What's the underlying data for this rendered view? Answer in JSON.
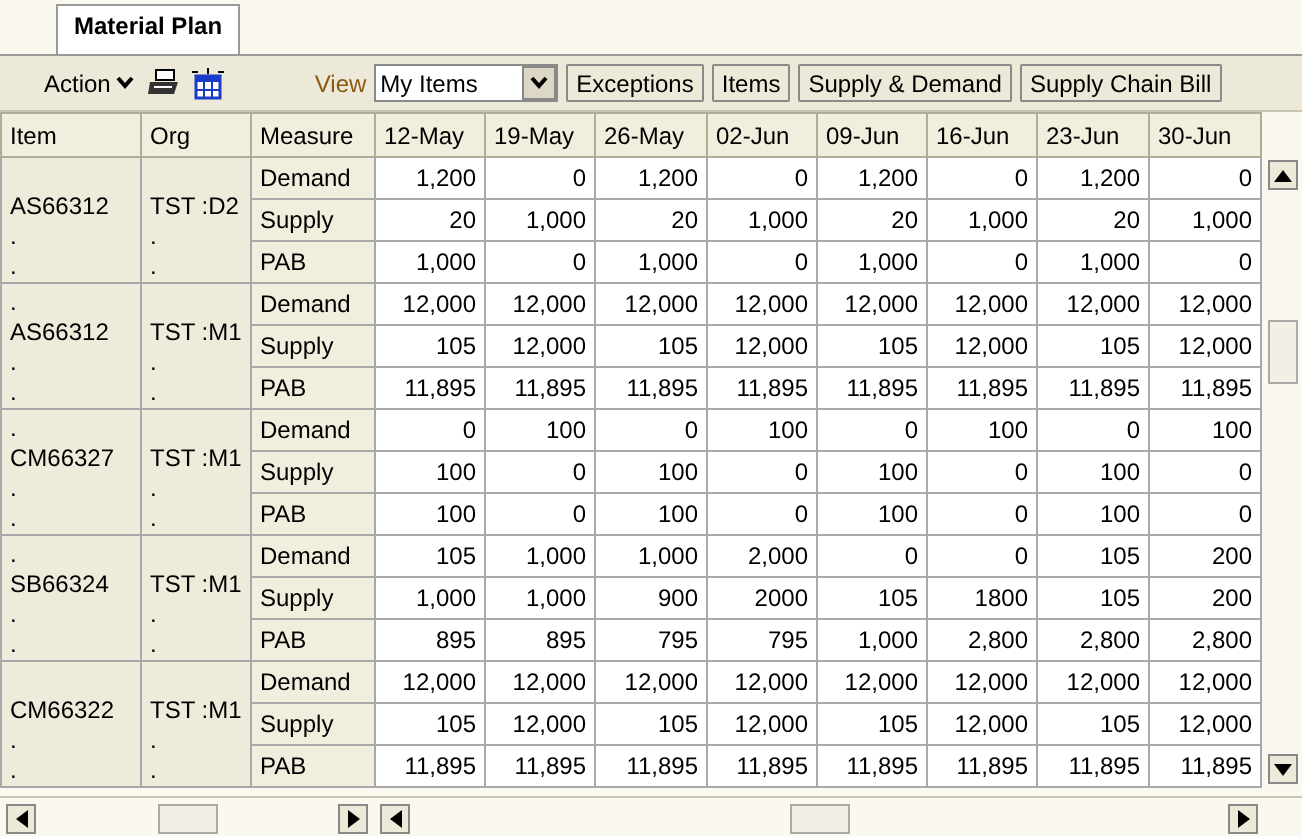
{
  "tabs": [
    {
      "label": "Material Plan",
      "selected": true
    }
  ],
  "toolbar": {
    "action_label": "Action",
    "view_label": "View",
    "view_value": "My Items",
    "buttons": [
      "Exceptions",
      "Items",
      "Supply & Demand",
      "Supply Chain Bill"
    ]
  },
  "table": {
    "columns": [
      "Item",
      "Org",
      "Measure",
      "12-May",
      "19-May",
      "26-May",
      "02-Jun",
      "09-Jun",
      "16-Jun",
      "23-Jun",
      "30-Jun"
    ],
    "groups": [
      {
        "item": [
          "AS66312",
          ".",
          "."
        ],
        "org": [
          "TST :D2",
          ".",
          "."
        ],
        "rows": [
          {
            "measure": "Demand",
            "values": [
              "1,200",
              "0",
              "1,200",
              "0",
              "1,200",
              "0",
              "1,200",
              "0"
            ]
          },
          {
            "measure": "Supply",
            "values": [
              "20",
              "1,000",
              "20",
              "1,000",
              "20",
              "1,000",
              "20",
              "1,000"
            ]
          },
          {
            "measure": "PAB",
            "values": [
              "1,000",
              "0",
              "1,000",
              "0",
              "1,000",
              "0",
              "1,000",
              "0"
            ]
          }
        ]
      },
      {
        "item": [
          ".",
          "AS66312",
          ".",
          "."
        ],
        "org": [
          "TST :M1",
          ".",
          "."
        ],
        "rows": [
          {
            "measure": "Demand",
            "values": [
              "12,000",
              "12,000",
              "12,000",
              "12,000",
              "12,000",
              "12,000",
              "12,000",
              "12,000"
            ]
          },
          {
            "measure": "Supply",
            "values": [
              "105",
              "12,000",
              "105",
              "12,000",
              "105",
              "12,000",
              "105",
              "12,000"
            ]
          },
          {
            "measure": "PAB",
            "values": [
              "11,895",
              "11,895",
              "11,895",
              "11,895",
              "11,895",
              "11,895",
              "11,895",
              "11,895"
            ]
          }
        ]
      },
      {
        "item": [
          ".",
          "CM66327",
          ".",
          "."
        ],
        "org": [
          "TST :M1",
          ".",
          "."
        ],
        "rows": [
          {
            "measure": "Demand",
            "values": [
              "0",
              "100",
              "0",
              "100",
              "0",
              "100",
              "0",
              "100"
            ]
          },
          {
            "measure": "Supply",
            "values": [
              "100",
              "0",
              "100",
              "0",
              "100",
              "0",
              "100",
              "0"
            ]
          },
          {
            "measure": "PAB",
            "values": [
              "100",
              "0",
              "100",
              "0",
              "100",
              "0",
              "100",
              "0"
            ]
          }
        ]
      },
      {
        "item": [
          ".",
          "SB66324",
          ".",
          "."
        ],
        "org": [
          "TST :M1",
          ".",
          "."
        ],
        "rows": [
          {
            "measure": "Demand",
            "values": [
              "105",
              "1,000",
              "1,000",
              "2,000",
              "0",
              "0",
              "105",
              "200"
            ]
          },
          {
            "measure": "Supply",
            "values": [
              "1,000",
              "1,000",
              "900",
              "2000",
              "105",
              "1800",
              "105",
              "200"
            ]
          },
          {
            "measure": "PAB",
            "values": [
              "895",
              "895",
              "795",
              "795",
              "1,000",
              "2,800",
              "2,800",
              "2,800"
            ]
          }
        ]
      },
      {
        "item": [
          "CM66322",
          ".",
          "."
        ],
        "org": [
          "TST :M1",
          ".",
          "."
        ],
        "rows": [
          {
            "measure": "Demand",
            "values": [
              "12,000",
              "12,000",
              "12,000",
              "12,000",
              "12,000",
              "12,000",
              "12,000",
              "12,000"
            ]
          },
          {
            "measure": "Supply",
            "values": [
              "105",
              "12,000",
              "105",
              "12,000",
              "105",
              "12,000",
              "105",
              "12,000"
            ]
          },
          {
            "measure": "PAB",
            "values": [
              "11,895",
              "11,895",
              "11,895",
              "11,895",
              "11,895",
              "11,895",
              "11,895",
              "11,895"
            ]
          }
        ]
      }
    ]
  }
}
